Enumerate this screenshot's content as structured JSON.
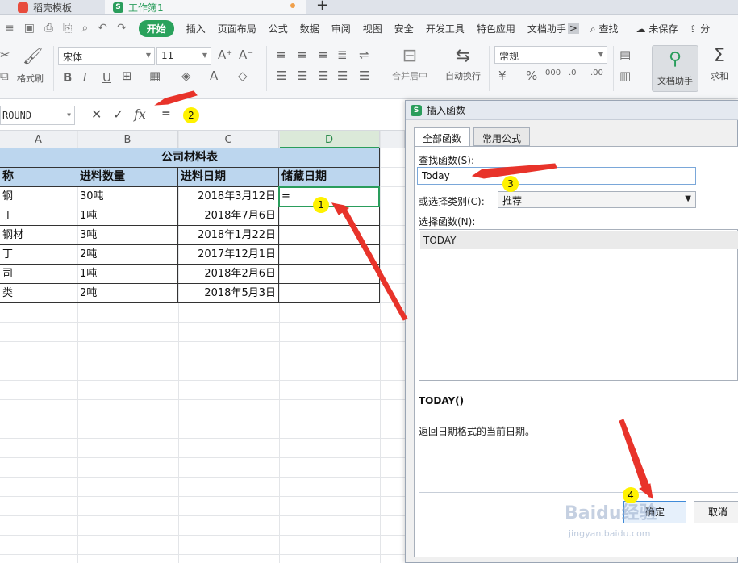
{
  "tabs": {
    "template": "稻壳模板",
    "workbook": "工作簿1",
    "new_tab": "+"
  },
  "menu": {
    "items": [
      "开始",
      "插入",
      "页面布局",
      "公式",
      "数据",
      "审阅",
      "视图",
      "安全",
      "开发工具",
      "特色应用",
      "文档助手"
    ],
    "more": ">",
    "search": "查找",
    "save_status": "未保存",
    "share": "分"
  },
  "ribbon": {
    "format_painter": "格式刷",
    "font_name": "宋体",
    "font_size": "11",
    "merge_center": "合并居中",
    "wrap_text": "自动换行",
    "number_format": "常规",
    "doc_helper": "文档助手",
    "sum": "求和"
  },
  "formula_bar": {
    "name_box": "ROUND",
    "cancel_icon": "✕",
    "confirm_icon": "✓",
    "fx": "fx",
    "value": "="
  },
  "sheet": {
    "columns": [
      "A",
      "B",
      "C",
      "D"
    ],
    "title": "公司材料表",
    "headers": [
      "称",
      "进料数量",
      "进料日期",
      "储藏日期"
    ],
    "rows": [
      [
        "钢",
        "30吨",
        "2018年3月12日",
        "="
      ],
      [
        "丁",
        "1吨",
        "2018年7月6日",
        ""
      ],
      [
        "钢材",
        "3吨",
        "2018年1月22日",
        ""
      ],
      [
        "丁",
        "2吨",
        "2017年12月1日",
        ""
      ],
      [
        "司",
        "1吨",
        "2018年2月6日",
        ""
      ],
      [
        "类",
        "2吨",
        "2018年5月3日",
        ""
      ]
    ]
  },
  "dialog": {
    "title": "插入函数",
    "tab_all": "全部函数",
    "tab_common": "常用公式",
    "search_label": "查找函数(S):",
    "search_value": "Today",
    "category_label": "或选择类别(C):",
    "category_value": "推荐",
    "select_label": "选择函数(N):",
    "functions": [
      "TODAY"
    ],
    "signature": "TODAY()",
    "description": "返回日期格式的当前日期。",
    "ok": "确定",
    "cancel": "取消"
  },
  "annotations": {
    "badges": [
      "1",
      "2",
      "3",
      "4"
    ],
    "color": "#fff200",
    "arrow_color": "#e8332a"
  },
  "watermark": {
    "brand": "Baidu经验",
    "url": "jingyan.baidu.com"
  },
  "colors": {
    "accent": "#2a9d5c",
    "header_fill": "#bcd6ee"
  }
}
